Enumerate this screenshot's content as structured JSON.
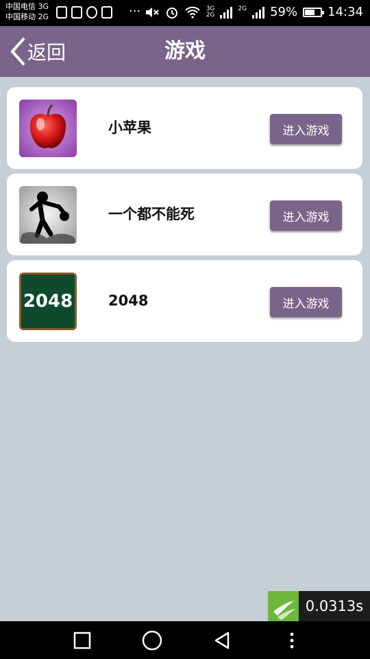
{
  "status_bar": {
    "carrier_1": "中国电信 3G",
    "carrier_2": "中国移动 2G",
    "dots": "···",
    "net_tag_1": "3G",
    "net_tag_2": "2G",
    "net_tag_3": "2G",
    "battery": "59%",
    "battery_level": 0.59,
    "time": "14:34"
  },
  "header": {
    "back_label": "返回",
    "title": "游戏"
  },
  "games": [
    {
      "name": "小苹果",
      "button": "进入游戏",
      "icon": "apple-icon"
    },
    {
      "name": "一个都不能死",
      "button": "进入游戏",
      "icon": "stickman-icon"
    },
    {
      "name": "2048",
      "button": "进入游戏",
      "icon": "2048-icon",
      "icon_text": "2048"
    }
  ],
  "timer": {
    "value": "0.0313s"
  },
  "colors": {
    "accent": "#7b6489",
    "background": "#c6ced6",
    "timer_green": "#6fb73d"
  }
}
